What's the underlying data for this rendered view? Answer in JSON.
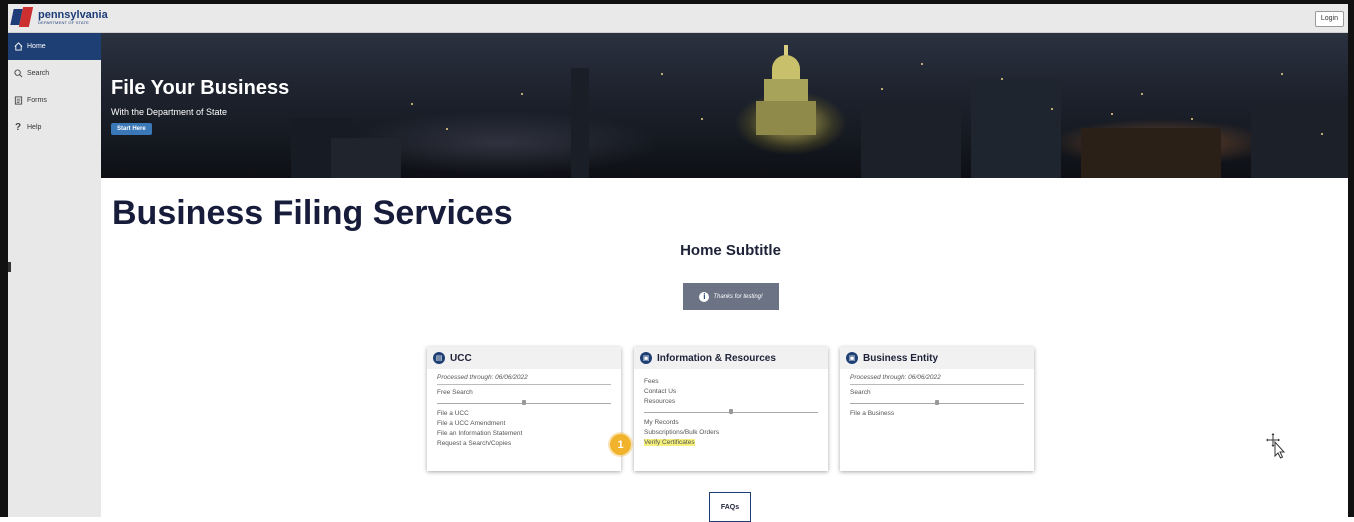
{
  "header": {
    "logo_name": "pennsylvania",
    "logo_sub": "DEPARTMENT OF STATE",
    "login_label": "Login"
  },
  "sidebar": {
    "items": [
      {
        "label": "Home",
        "icon": "home-icon",
        "active": true
      },
      {
        "label": "Search",
        "icon": "search-icon",
        "active": false
      },
      {
        "label": "Forms",
        "icon": "forms-icon",
        "active": false
      },
      {
        "label": "Help",
        "icon": "help-icon",
        "active": false
      }
    ]
  },
  "hero": {
    "title": "File Your Business",
    "subtitle": "With the Department of State",
    "button_label": "Start Here"
  },
  "main": {
    "page_title": "Business Filing Services",
    "subtitle": "Home Subtitle",
    "notice": "Thanks for testing!",
    "faqs_label": "FAQs"
  },
  "cards": {
    "ucc": {
      "title": "UCC",
      "processed": "Processed through: 06/06/2022",
      "links_top": [
        "Free Search"
      ],
      "links_bottom": [
        "File a UCC",
        "File a UCC Amendment",
        "File an Information Statement",
        "Request a Search/Copies"
      ]
    },
    "info": {
      "title": "Information & Resources",
      "links_top": [
        "Fees",
        "Contact Us",
        "Resources"
      ],
      "links_bottom": [
        "My Records",
        "Subscriptions/Bulk Orders",
        "Verify Certificates"
      ]
    },
    "business": {
      "title": "Business Entity",
      "processed": "Processed through: 06/06/2022",
      "links_top": [
        "Search"
      ],
      "links_bottom": [
        "File a Business"
      ]
    }
  },
  "annotation": {
    "badge": "1"
  },
  "colors": {
    "brand_navy": "#1e3f74",
    "brand_red": "#cc2f2f",
    "highlight": "#f5f07a",
    "badge": "#f1b32c"
  }
}
